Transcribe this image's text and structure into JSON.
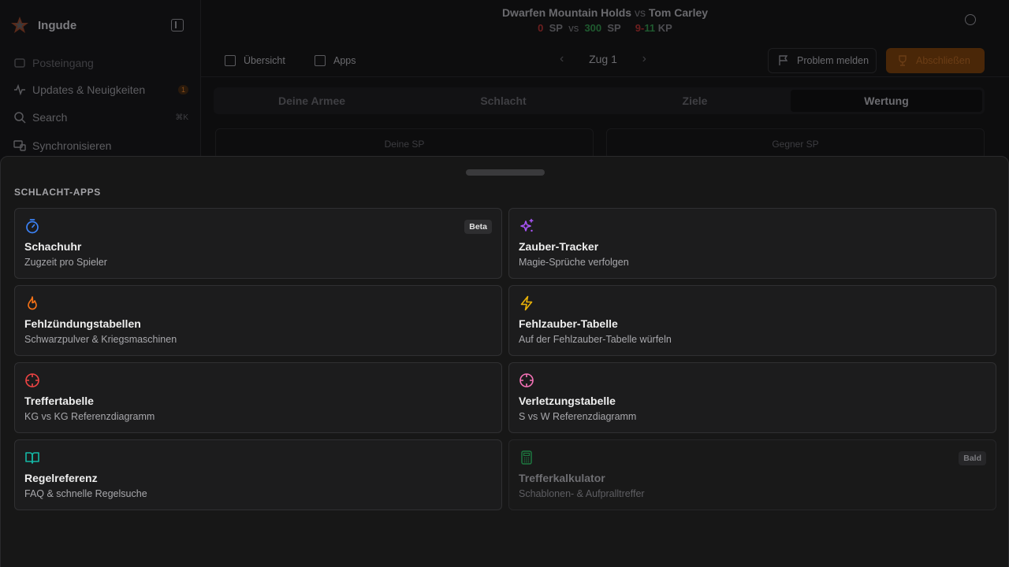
{
  "sidebar": {
    "brand": "Ingude",
    "items": [
      {
        "label": "Posteingang",
        "icon": "inbox-icon"
      },
      {
        "label": "Updates & Neuigkeiten",
        "icon": "activity-icon",
        "badge": "1"
      },
      {
        "label": "Search",
        "icon": "search-icon",
        "shortcut": "⌘K"
      },
      {
        "label": "Synchronisieren",
        "icon": "sync-icon"
      }
    ]
  },
  "header": {
    "player1": "Dwarfen Mountain Holds",
    "vs": "vs",
    "player2": "Tom Carley",
    "score1": "0",
    "sp_label": "SP",
    "score2": "300",
    "kp1": "9",
    "kp_dash": "-",
    "kp2": "11",
    "kp_label": "KP"
  },
  "toolbar": {
    "overview": "Übersicht",
    "apps": "Apps",
    "turn": "Zug 1",
    "report": "Problem melden",
    "finish": "Abschließen"
  },
  "tabs": [
    "Deine Armee",
    "Schlacht",
    "Ziele",
    "Wertung"
  ],
  "score_cards": {
    "mine": "Deine SP",
    "opponent": "Gegner SP"
  },
  "sheet": {
    "title": "SCHLACHT-APPS",
    "apps": [
      {
        "title": "Schachuhr",
        "subtitle": "Zugzeit pro Spieler",
        "icon": "stopwatch-icon",
        "badge": "Beta",
        "color": "#3b82f6"
      },
      {
        "title": "Zauber-Tracker",
        "subtitle": "Magie-Sprüche verfolgen",
        "icon": "sparkles-icon",
        "color": "#a855f7"
      },
      {
        "title": "Fehlzündungstabellen",
        "subtitle": "Schwarzpulver & Kriegsmaschinen",
        "icon": "flame-icon",
        "color": "#f97316"
      },
      {
        "title": "Fehlzauber-Tabelle",
        "subtitle": "Auf der Fehlzauber-Tabelle würfeln",
        "icon": "lightning-icon",
        "color": "#eab308"
      },
      {
        "title": "Treffertabelle",
        "subtitle": "KG vs KG Referenzdiagramm",
        "icon": "crosshair-icon",
        "color": "#ef4444"
      },
      {
        "title": "Verletzungstabelle",
        "subtitle": "S vs W Referenzdiagramm",
        "icon": "crosshair-icon",
        "color": "#f472b6"
      },
      {
        "title": "Regelreferenz",
        "subtitle": "FAQ & schnelle Regelsuche",
        "icon": "book-icon",
        "color": "#14b8a6"
      },
      {
        "title": "Trefferkalkulator",
        "subtitle": "Schablonen- & Aufpralltreffer",
        "icon": "calculator-icon",
        "badge": "Bald",
        "color": "#22c55e",
        "disabled": true
      }
    ]
  }
}
